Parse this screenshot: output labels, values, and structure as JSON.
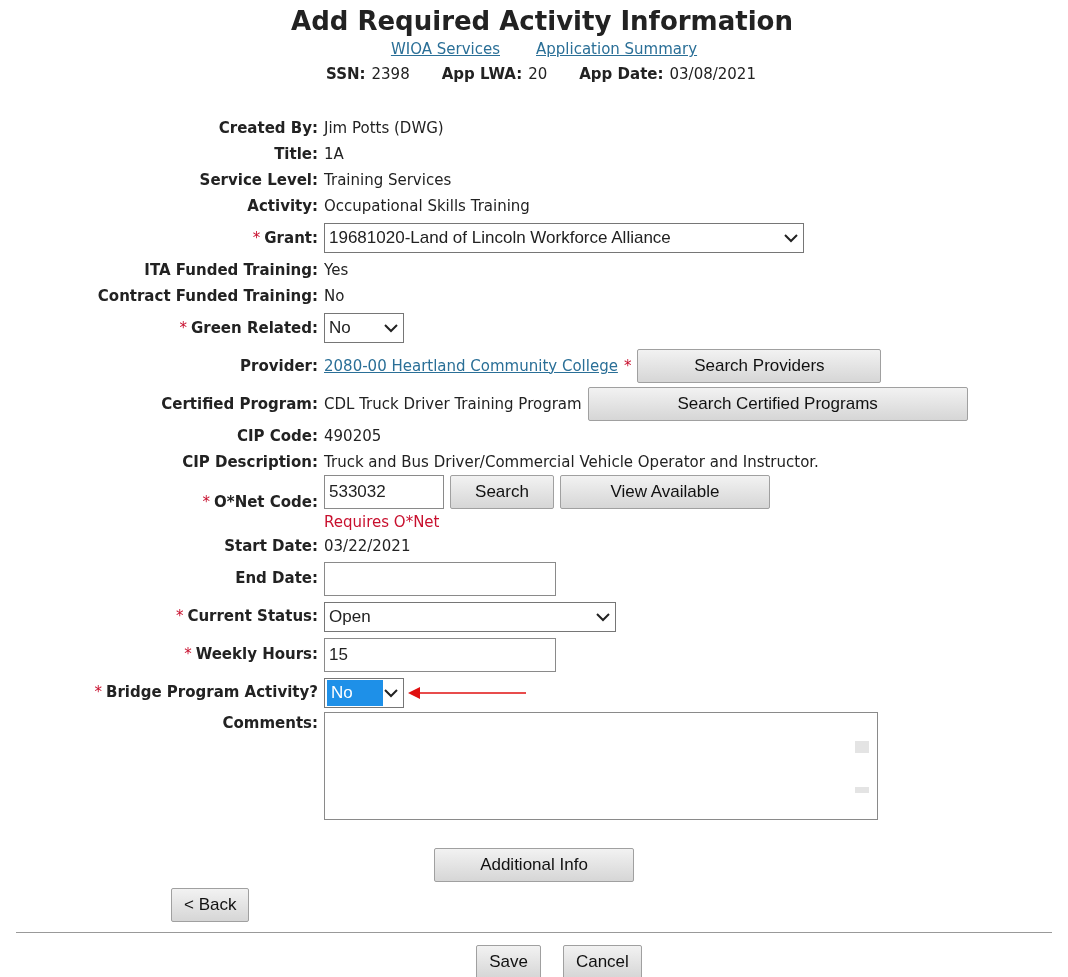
{
  "title": "Add Required Activity Information",
  "links": [
    "WIOA Services",
    "Application Summary"
  ],
  "summary": [
    {
      "label": "SSN:",
      "value": "2398"
    },
    {
      "label": "App LWA:",
      "value": "20"
    },
    {
      "label": "App Date:",
      "value": "03/08/2021"
    }
  ],
  "fields": [
    {
      "kind": "text",
      "label": "Created By:",
      "value": "Jim Potts (DWG)"
    },
    {
      "kind": "text",
      "label": "Title:",
      "value": "1A"
    },
    {
      "kind": "text",
      "label": "Service Level:",
      "value": "Training Services"
    },
    {
      "kind": "text",
      "label": "Activity:",
      "value": "Occupational Skills Training"
    },
    {
      "kind": "select",
      "marker": "*",
      "label": "Grant:",
      "value": "19681020-Land of Lincoln Workforce Alliance",
      "highlighted": false
    },
    {
      "kind": "text",
      "label": "ITA Funded Training:",
      "value": "Yes"
    },
    {
      "kind": "text",
      "label": "Contract Funded Training:",
      "value": "No"
    },
    {
      "kind": "select",
      "marker": "*",
      "label": "Green Related:",
      "value": "No",
      "highlighted": false
    },
    {
      "kind": "link",
      "label": "Provider:",
      "value": "2080-00 Heartland Community College",
      "marker": "*",
      "buttons": [
        "Search Providers"
      ]
    },
    {
      "kind": "text",
      "label": "Certified Program:",
      "value": "CDL Truck Driver Training Program",
      "buttons": [
        "Search Certified Programs"
      ]
    },
    {
      "kind": "text",
      "label": "CIP Code:",
      "value": "490205"
    },
    {
      "kind": "text",
      "label": "CIP Description:",
      "value": "Truck and Bus Driver/Commercial Vehicle Operator and Instructor."
    },
    {
      "kind": "input",
      "marker": "*",
      "label": "O*Net Code:",
      "value": "533032",
      "buttons": [
        "Search",
        "View Available"
      ],
      "error": "Requires O*Net"
    },
    {
      "kind": "text",
      "label": "Start Date:",
      "value": "03/22/2021"
    },
    {
      "kind": "input",
      "label": "End Date:"
    },
    {
      "kind": "select",
      "marker": "*",
      "label": "Current Status:",
      "value": "Open",
      "highlighted": false
    },
    {
      "kind": "input",
      "marker": "*",
      "label": "Weekly Hours:",
      "value": "15"
    },
    {
      "kind": "select",
      "marker": "*",
      "label": "Bridge Program Activity?",
      "value": "No",
      "highlighted": true,
      "annotated": true
    },
    {
      "kind": "textarea",
      "label": "Comments:"
    }
  ],
  "additional_button": "Additional Info",
  "back_button": "< Back",
  "footer_buttons": [
    "Save",
    "Cancel"
  ]
}
